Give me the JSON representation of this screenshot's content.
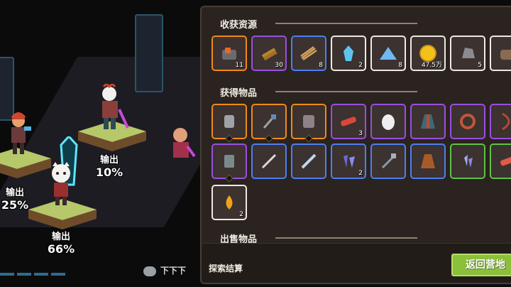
{
  "units": [
    {
      "label": "输出",
      "percent": "25%"
    },
    {
      "label": "输出",
      "percent": "10%"
    },
    {
      "label": "输出",
      "percent": "66%"
    }
  ],
  "chat": {
    "text": "下下下"
  },
  "panel": {
    "harvest_title": "收获资源",
    "items_title": "获得物品",
    "sell_title": "出售物品",
    "footer_label": "探索结算",
    "return_button": "返回营地"
  },
  "resources": [
    {
      "icon": "ore-icon",
      "rarity": "orange",
      "count": "11"
    },
    {
      "icon": "wood-icon",
      "rarity": "purple",
      "count": "30"
    },
    {
      "icon": "straw-icon",
      "rarity": "blue",
      "count": "8"
    },
    {
      "icon": "crystal-icon",
      "rarity": "white",
      "count": "2"
    },
    {
      "icon": "powder-icon",
      "rarity": "white",
      "count": "8"
    },
    {
      "icon": "gold-coin-icon",
      "rarity": "white",
      "count": "47.5万"
    },
    {
      "icon": "iron-ore-icon",
      "rarity": "white",
      "count": "5"
    },
    {
      "icon": "rock-icon",
      "rarity": "white",
      "count": ""
    }
  ],
  "items_row1": [
    {
      "icon": "armor-icon",
      "rarity": "orange",
      "count": ""
    },
    {
      "icon": "axe-icon",
      "rarity": "orange",
      "count": ""
    },
    {
      "icon": "chest-armor-icon",
      "rarity": "orange",
      "count": ""
    },
    {
      "icon": "bacon-icon",
      "rarity": "purple",
      "count": "3"
    },
    {
      "icon": "egg-icon",
      "rarity": "purple",
      "count": ""
    },
    {
      "icon": "robe-icon",
      "rarity": "purple",
      "count": ""
    },
    {
      "icon": "ring-icon",
      "rarity": "purple",
      "count": ""
    },
    {
      "icon": "bow-icon",
      "rarity": "purple",
      "count": ""
    }
  ],
  "items_row2": [
    {
      "icon": "vest-icon",
      "rarity": "purple",
      "count": ""
    },
    {
      "icon": "sword-icon",
      "rarity": "blue",
      "count": ""
    },
    {
      "icon": "blade-icon",
      "rarity": "blue",
      "count": ""
    },
    {
      "icon": "gem-shards-icon",
      "rarity": "blue",
      "count": "2"
    },
    {
      "icon": "halberd-icon",
      "rarity": "blue",
      "count": ""
    },
    {
      "icon": "cloak-icon",
      "rarity": "blue",
      "count": ""
    },
    {
      "icon": "shards-icon",
      "rarity": "green",
      "count": ""
    },
    {
      "icon": "meat-icon",
      "rarity": "green",
      "count": ""
    }
  ],
  "items_row3": [
    {
      "icon": "potion-drop-icon",
      "rarity": "white",
      "count": "2"
    }
  ],
  "colors": {
    "orange": "#f08a18",
    "purple": "#9b4ee0",
    "blue": "#4d7ef0",
    "white": "#efe9df",
    "green": "#5fc145",
    "button": "#8cbf3a"
  }
}
